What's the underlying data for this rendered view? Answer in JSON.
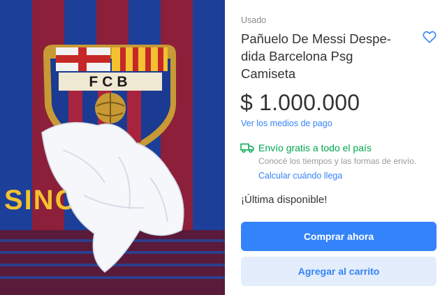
{
  "product_image": {
    "icon": "fcb-scarf-with-tissue-photo",
    "crest_letters": "FCB",
    "scarf_text": "SINCE 1899"
  },
  "product": {
    "condition": "Usado",
    "title": "Pañuelo De Messi Despe-dida Barcelona Psg Camiseta",
    "price": "$ 1.000.000",
    "payment_link": "Ver los medios de pago"
  },
  "shipping": {
    "icon": "truck-icon",
    "free_label": "Envío gratis a todo el país",
    "description": "Conocé los tiempos y las formas de envío.",
    "calc_link": "Calcular cuándo llega"
  },
  "stock": {
    "label": "¡Última disponible!"
  },
  "actions": {
    "buy_label": "Comprar ahora",
    "cart_label": "Agregar al carrito"
  },
  "colors": {
    "accent": "#3483fa",
    "free_shipping": "#00a650",
    "cart_bg": "#e3edfb",
    "text": "#333333"
  }
}
